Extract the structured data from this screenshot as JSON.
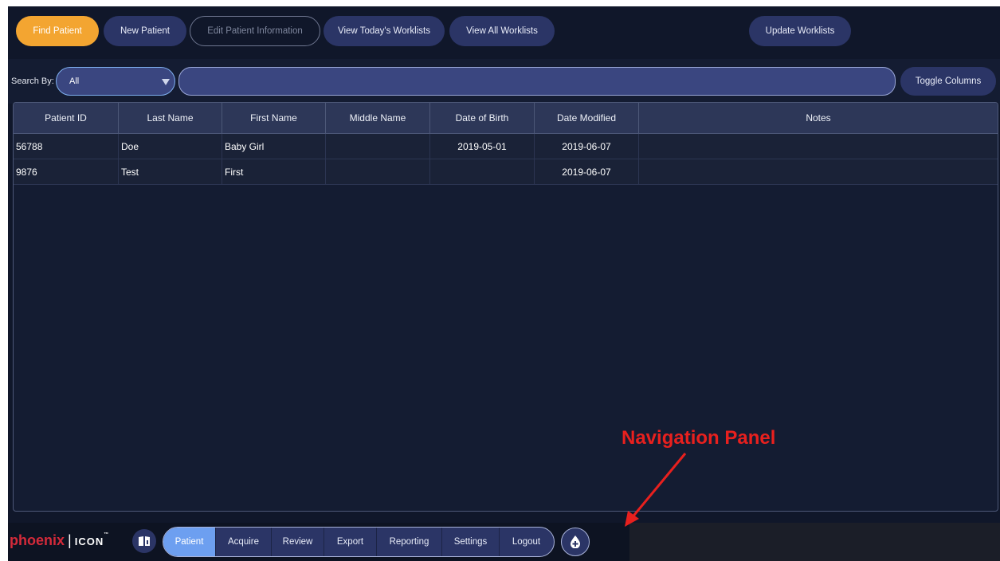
{
  "toolbar": {
    "buttons": [
      {
        "label": "Find Patient"
      },
      {
        "label": "New Patient"
      },
      {
        "label": "Edit Patient Information"
      },
      {
        "label": "View Today's Worklists"
      },
      {
        "label": "View All Worklists"
      },
      {
        "label": "Update Worklists"
      }
    ]
  },
  "search": {
    "label": "Search By:",
    "selected": "All",
    "value": "",
    "toggle_label": "Toggle Columns"
  },
  "table": {
    "columns": [
      "Patient ID",
      "Last Name",
      "First Name",
      "Middle Name",
      "Date of Birth",
      "Date Modified",
      "Notes"
    ],
    "rows": [
      [
        "56788",
        "Doe",
        "Baby Girl",
        "",
        "2019-05-01",
        "2019-06-07",
        ""
      ],
      [
        "9876",
        "Test",
        "First",
        "",
        "",
        "2019-06-07",
        ""
      ]
    ]
  },
  "nav": {
    "logo_text": "phoenix",
    "logo_sub": "ICON",
    "logo_tm": "™",
    "items": [
      {
        "label": "Patient"
      },
      {
        "label": "Acquire"
      },
      {
        "label": "Review"
      },
      {
        "label": "Export"
      },
      {
        "label": "Reporting"
      },
      {
        "label": "Settings"
      },
      {
        "label": "Logout"
      }
    ],
    "active": "Patient"
  },
  "annotation": {
    "label": "Navigation Panel"
  },
  "colors": {
    "background": "#10172a",
    "button": "#2b3566",
    "active_button": "#f3a531",
    "nav_active": "#6d9ff0",
    "logo_red": "#d42a3a",
    "annotation_red": "#e8201e"
  }
}
